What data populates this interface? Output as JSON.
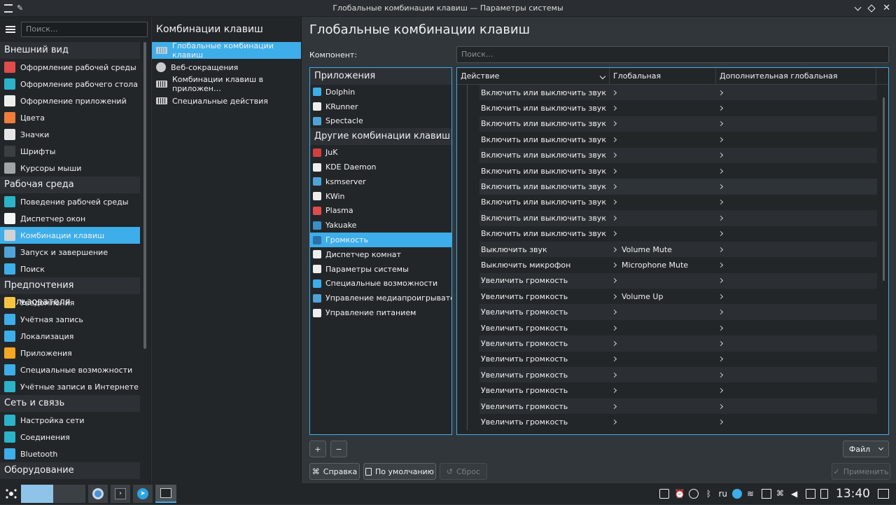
{
  "window": {
    "title": "Глобальные комбинации клавиш — Параметры системы"
  },
  "sidebar": {
    "search_placeholder": "Поиск...",
    "sections": [
      {
        "title": "Внешний вид",
        "items": [
          {
            "label": "Оформление рабочей среды",
            "icon": "palette-icon",
            "color": "#e04b4b"
          },
          {
            "label": "Оформление рабочего стола",
            "icon": "desktop-theme-icon",
            "color": "#2ab3c9"
          },
          {
            "label": "Оформление приложений",
            "icon": "brush-icon",
            "color": "#eeeeee"
          },
          {
            "label": "Цвета",
            "icon": "color-wheel-icon",
            "color": "#f07d3c"
          },
          {
            "label": "Значки",
            "icon": "icons-icon",
            "color": "#e6e6e6"
          },
          {
            "label": "Шрифты",
            "icon": "font-icon",
            "color": "#3a3f44"
          },
          {
            "label": "Курсоры мыши",
            "icon": "mouse-cursor-icon",
            "color": "#a0a4a8"
          }
        ]
      },
      {
        "title": "Рабочая среда",
        "items": [
          {
            "label": "Поведение рабочей среды",
            "icon": "desktop-behavior-icon",
            "color": "#2ab3c9"
          },
          {
            "label": "Диспетчер окон",
            "icon": "window-manager-icon",
            "color": "#f5f5f5"
          },
          {
            "label": "Комбинации клавиш",
            "icon": "keyboard-icon",
            "color": "#d0d2d4",
            "selected": true
          },
          {
            "label": "Запуск и завершение",
            "icon": "startup-icon",
            "color": "#4fa3d9"
          },
          {
            "label": "Поиск",
            "icon": "search-icon",
            "color": "#3daee9"
          }
        ]
      },
      {
        "title": "Предпочтения пользователя",
        "items": [
          {
            "label": "Уведомления",
            "icon": "bell-icon",
            "color": "#f5c542"
          },
          {
            "label": "Учётная запись",
            "icon": "user-account-icon",
            "color": "#3daee9"
          },
          {
            "label": "Локализация",
            "icon": "localization-icon",
            "color": "#3daee9"
          },
          {
            "label": "Приложения",
            "icon": "star-icon",
            "color": "#f5a623"
          },
          {
            "label": "Специальные возможности",
            "icon": "accessibility-icon",
            "color": "#3daee9"
          },
          {
            "label": "Учётные записи в Интернете",
            "icon": "globe-icon",
            "color": "#2ab3c9"
          }
        ]
      },
      {
        "title": "Сеть и связь",
        "items": [
          {
            "label": "Настройка сети",
            "icon": "network-globe-icon",
            "color": "#2ab3c9"
          },
          {
            "label": "Соединения",
            "icon": "connections-globe-icon",
            "color": "#2ab3c9"
          },
          {
            "label": "Bluetooth",
            "icon": "bluetooth-icon",
            "color": "#3daee9"
          }
        ]
      },
      {
        "title": "Оборудование",
        "items": []
      }
    ]
  },
  "category": {
    "title": "Комбинации клавиш",
    "items": [
      {
        "label": "Глобальные комбинации клавиш",
        "icon": "keyboard-icon",
        "selected": true
      },
      {
        "label": "Веб-сокращения",
        "icon": "web-globe-icon"
      },
      {
        "label": "Комбинации клавиш в приложен…",
        "icon": "keyboard-icon"
      },
      {
        "label": "Специальные действия",
        "icon": "keyboard-icon"
      }
    ]
  },
  "main": {
    "title": "Глобальные комбинации клавиш",
    "component_label": "Компонент:",
    "component_search_placeholder": "Поиск...",
    "components": {
      "apps_section": "Приложения",
      "apps": [
        {
          "label": "Dolphin",
          "icon": "dolphin-icon",
          "color": "#3daee9"
        },
        {
          "label": "KRunner",
          "icon": "krunner-icon",
          "color": "#eeeeee"
        },
        {
          "label": "Spectacle",
          "icon": "spectacle-icon",
          "color": "#4fa3d9"
        }
      ],
      "other_section": "Другие комбинации клавиш",
      "other": [
        {
          "label": "JuK",
          "icon": "juk-icon",
          "color": "#d04040"
        },
        {
          "label": "KDE Daemon",
          "icon": "kde-daemon-icon",
          "color": "#eeeeee"
        },
        {
          "label": "ksmserver",
          "icon": "ksmserver-icon",
          "color": "#4fa3d9"
        },
        {
          "label": "KWin",
          "icon": "kwin-icon",
          "color": "#eeeeee"
        },
        {
          "label": "Plasma",
          "icon": "plasma-icon",
          "color": "#e04b4b"
        },
        {
          "label": "Yakuake",
          "icon": "yakuake-icon",
          "color": "#3a8fc7"
        },
        {
          "label": "Громкость",
          "icon": "volume-icon",
          "color": "#2b6fa8",
          "selected": true
        },
        {
          "label": "Диспетчер комнат",
          "icon": "activities-icon",
          "color": "#eeeeee"
        },
        {
          "label": "Параметры системы",
          "icon": "system-settings-icon",
          "color": "#eeeeee"
        },
        {
          "label": "Специальные возможности",
          "icon": "accessibility-icon",
          "color": "#3daee9"
        },
        {
          "label": "Управление медиапроигрывател…",
          "icon": "media-player-icon",
          "color": "#4fa3d9"
        },
        {
          "label": "Управление питанием",
          "icon": "power-management-icon",
          "color": "#eeeeee"
        }
      ]
    },
    "table": {
      "headers": [
        "Действие",
        "Глобальная",
        "Дополнительная глобальная"
      ],
      "rows": [
        {
          "action": "Включить или выключить звук",
          "global": "",
          "alt": ""
        },
        {
          "action": "Включить или выключить звук",
          "global": "",
          "alt": ""
        },
        {
          "action": "Включить или выключить звук",
          "global": "",
          "alt": ""
        },
        {
          "action": "Включить или выключить звук",
          "global": "",
          "alt": ""
        },
        {
          "action": "Включить или выключить звук",
          "global": "",
          "alt": ""
        },
        {
          "action": "Включить или выключить звук",
          "global": "",
          "alt": ""
        },
        {
          "action": "Включить или выключить звук",
          "global": "",
          "alt": "",
          "hover": true
        },
        {
          "action": "Включить или выключить звук",
          "global": "",
          "alt": ""
        },
        {
          "action": "Включить или выключить звук",
          "global": "",
          "alt": ""
        },
        {
          "action": "Включить или выключить звук",
          "global": "",
          "alt": ""
        },
        {
          "action": "Выключить звук",
          "global": "Volume Mute",
          "alt": ""
        },
        {
          "action": "Выключить микрофон",
          "global": "Microphone Mute",
          "alt": ""
        },
        {
          "action": "Увеличить громкость",
          "global": "",
          "alt": ""
        },
        {
          "action": "Увеличить громкость",
          "global": "Volume Up",
          "alt": ""
        },
        {
          "action": "Увеличить громкость",
          "global": "",
          "alt": ""
        },
        {
          "action": "Увеличить громкость",
          "global": "",
          "alt": ""
        },
        {
          "action": "Увеличить громкость",
          "global": "",
          "alt": ""
        },
        {
          "action": "Увеличить громкость",
          "global": "",
          "alt": ""
        },
        {
          "action": "Увеличить громкость",
          "global": "",
          "alt": ""
        },
        {
          "action": "Увеличить громкость",
          "global": "",
          "alt": ""
        },
        {
          "action": "Увеличить громкость",
          "global": "",
          "alt": ""
        },
        {
          "action": "Увеличить громкость",
          "global": "",
          "alt": ""
        }
      ]
    },
    "buttons": {
      "add": "+",
      "remove": "−",
      "file": "Файл",
      "help": "Справка",
      "defaults": "По умолчанию",
      "reset": "Сброс",
      "apply": "Применить"
    }
  },
  "taskbar": {
    "language": "ru",
    "clock": "13:40"
  },
  "colors": {
    "accent": "#3daee9",
    "bg": "#31363b",
    "view": "#232629"
  }
}
